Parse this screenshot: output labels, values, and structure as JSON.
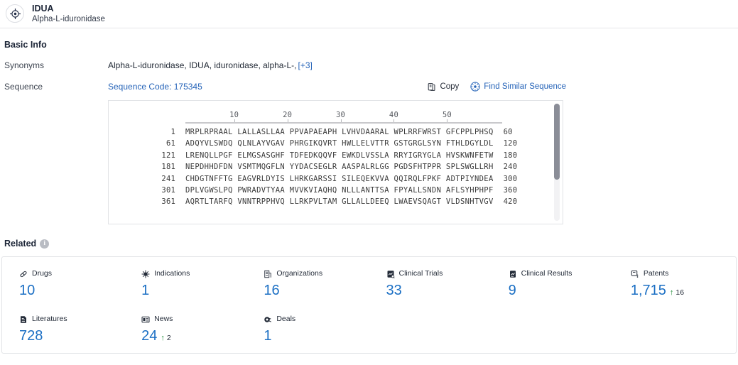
{
  "header": {
    "icon": "target-icon",
    "title": "IDUA",
    "subtitle": "Alpha-L-iduronidase"
  },
  "basic_info": {
    "section_title": "Basic Info",
    "synonyms_label": "Synonyms",
    "synonyms_value": "Alpha-L-iduronidase,  IDUA,  iduronidase, alpha-L-,",
    "synonyms_more": "[+3]",
    "sequence_label": "Sequence",
    "sequence_code": "Sequence Code: 175345",
    "copy_label": "Copy",
    "find_similar_label": "Find Similar Sequence"
  },
  "sequence": {
    "ruler": [
      10,
      20,
      30,
      40,
      50
    ],
    "rows": [
      {
        "start": "1",
        "chunks": "MRPLRPRAAL LALLASLLAA PPVAPAEAPH LVHVDAARAL WPLRRFWRST GFCPPLPHSQ",
        "end": "60"
      },
      {
        "start": "61",
        "chunks": "ADQYVLSWDQ QLNLAYVGAV PHRGIKQVRT HWLLELVTTR GSTGRGLSYN FTHLDGYLDL",
        "end": "120"
      },
      {
        "start": "121",
        "chunks": "LRENQLLPGF ELMGSASGHF TDFEDKQQVF EWKDLVSSLA RRYIGRYGLA HVSKWNFETW",
        "end": "180"
      },
      {
        "start": "181",
        "chunks": "NEPDHHDFDN VSMTMQGFLN YYDACSEGLR AASPALRLGG PGDSFHTPPR SPLSWGLLRH",
        "end": "240"
      },
      {
        "start": "241",
        "chunks": "CHDGTNFFTG EAGVRLDYIS LHRKGARSSI SILEQEKVVA QQIRQLFPKF ADTPIYNDEA",
        "end": "300"
      },
      {
        "start": "301",
        "chunks": "DPLVGWSLPQ PWRADVTYAA MVVKVIAQHQ NLLLANTTSA FPYALLSNDN AFLSYHPHPF",
        "end": "360"
      },
      {
        "start": "361",
        "chunks": "AQRTLTARFQ VNNTRPPHVQ LLRKPVLTAM GLLALLDEEQ LWAEVSQAGT VLDSNHTVGV",
        "end": "420"
      }
    ]
  },
  "related": {
    "title": "Related",
    "info_glyph": "i",
    "stats": [
      {
        "icon": "pill-icon",
        "label": "Drugs",
        "value": "10",
        "delta": null
      },
      {
        "icon": "virus-icon",
        "label": "Indications",
        "value": "1",
        "delta": null
      },
      {
        "icon": "building-icon",
        "label": "Organizations",
        "value": "16",
        "delta": null
      },
      {
        "icon": "clinical-trial-icon",
        "label": "Clinical Trials",
        "value": "33",
        "delta": null
      },
      {
        "icon": "clinical-result-icon",
        "label": "Clinical Results",
        "value": "9",
        "delta": null
      },
      {
        "icon": "patent-icon",
        "label": "Patents",
        "value": "1,715",
        "delta": "16"
      },
      {
        "icon": "literature-icon",
        "label": "Literatures",
        "value": "728",
        "delta": null
      },
      {
        "icon": "news-icon",
        "label": "News",
        "value": "24",
        "delta": "2"
      },
      {
        "icon": "deal-icon",
        "label": "Deals",
        "value": "1",
        "delta": null
      }
    ],
    "delta_arrow": "↑"
  },
  "colors": {
    "link": "#2563b8",
    "stat_value": "#1b6fc4",
    "delta_green": "#1a8a33",
    "text_dark": "#1b2436",
    "border": "#e1e3e6"
  }
}
